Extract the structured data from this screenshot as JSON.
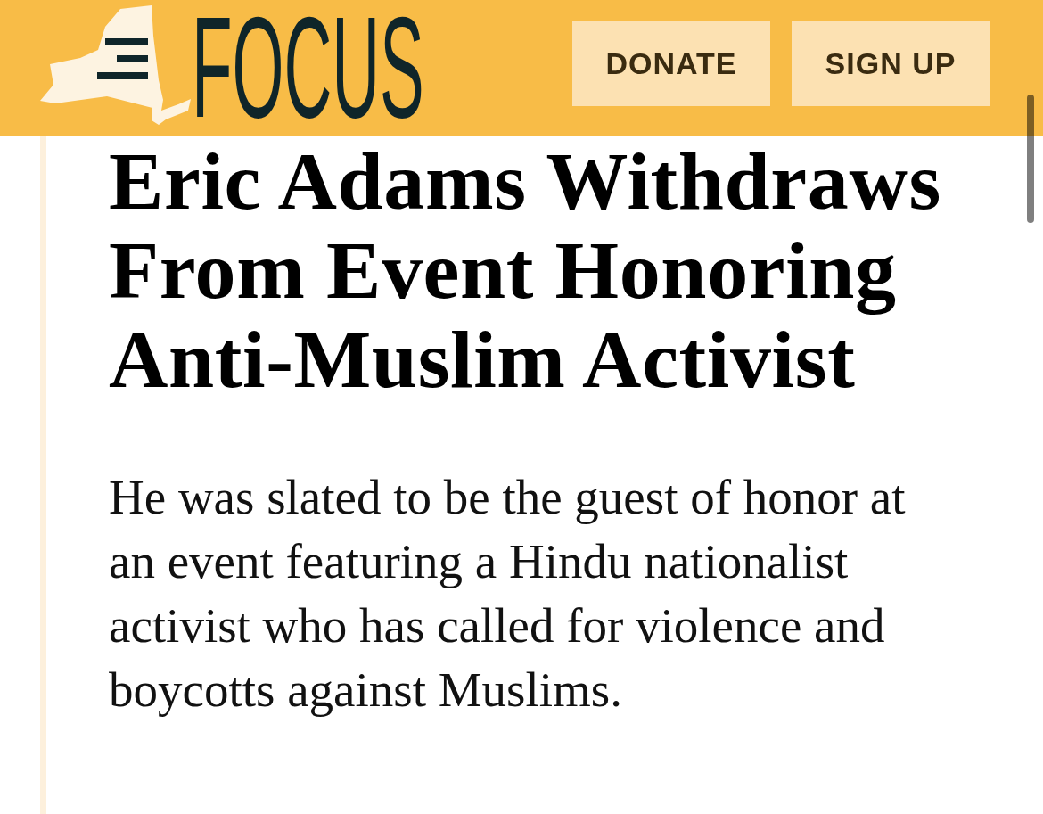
{
  "header": {
    "logo": {
      "text": "FOCUS"
    },
    "buttons": [
      {
        "label": "DONATE"
      },
      {
        "label": "SIGN UP"
      }
    ]
  },
  "article": {
    "headline": "Eric Adams Withdraws From Event Honoring Anti-Muslim Activist",
    "dek": "He was slated to be the guest of honor at an event featuring a Hindu nationalist activist who has called for violence and boycotts against Muslims."
  }
}
